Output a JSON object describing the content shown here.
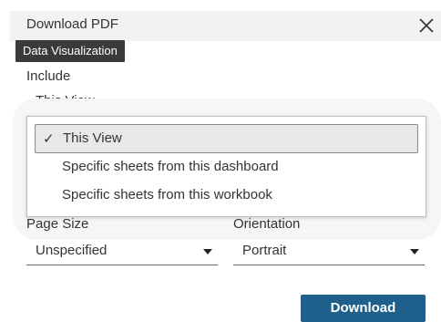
{
  "dialog": {
    "title": "Download PDF",
    "close_icon": "close-icon"
  },
  "tooltip": {
    "text": "Data Visualization"
  },
  "include": {
    "label": "Include",
    "value": "This View",
    "options": [
      {
        "label": "This View",
        "selected": true,
        "check": "✓"
      },
      {
        "label": "Specific sheets from this dashboard",
        "selected": false
      },
      {
        "label": "Specific sheets from this workbook",
        "selected": false
      }
    ]
  },
  "page_size": {
    "label": "Page Size",
    "value": "Unspecified"
  },
  "orientation": {
    "label": "Orientation",
    "value": "Portrait"
  },
  "download": {
    "label": "Download"
  },
  "colors": {
    "header_bg": "#f2f2f2",
    "tooltip_bg": "#3a3a3a",
    "primary_button": "#1e5f8c"
  }
}
